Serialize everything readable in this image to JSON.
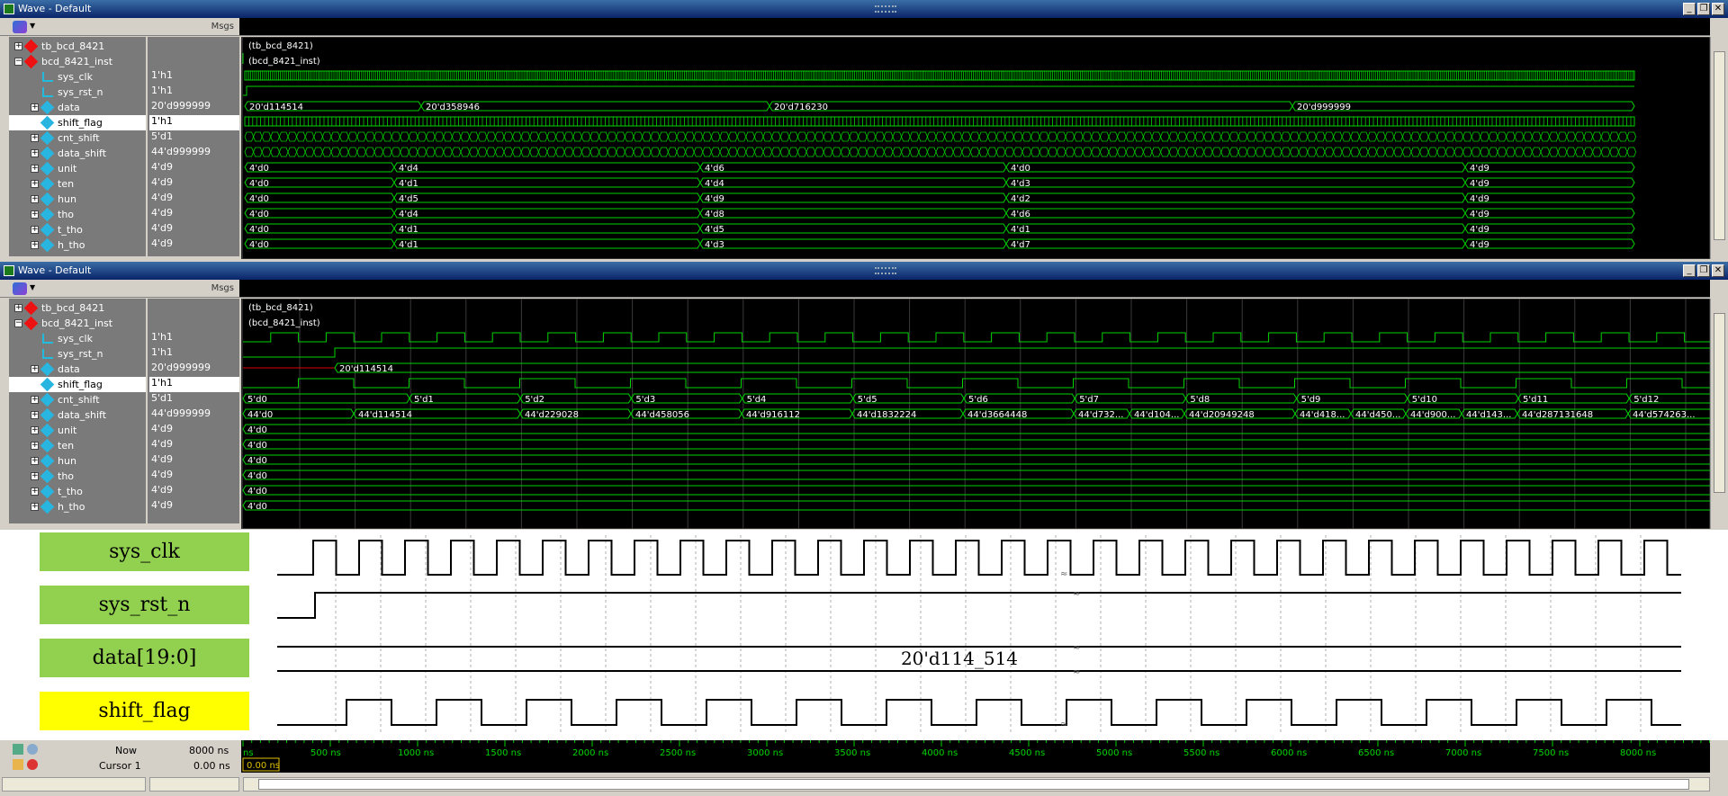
{
  "window1": {
    "title": "Wave - Default",
    "msgs_label": "Msgs",
    "group_labels": [
      "(tb_bcd_8421)",
      "(bcd_8421_inst)"
    ],
    "signals": [
      {
        "name": "tb_bcd_8421",
        "value": ""
      },
      {
        "name": "bcd_8421_inst",
        "value": ""
      },
      {
        "name": "sys_clk",
        "value": "1'h1"
      },
      {
        "name": "sys_rst_n",
        "value": "1'h1"
      },
      {
        "name": "data",
        "value": "20'd999999"
      },
      {
        "name": "shift_flag",
        "value": "1'h1"
      },
      {
        "name": "cnt_shift",
        "value": "5'd1"
      },
      {
        "name": "data_shift",
        "value": "44'd999999"
      },
      {
        "name": "unit",
        "value": "4'd9"
      },
      {
        "name": "ten",
        "value": "4'd9"
      },
      {
        "name": "hun",
        "value": "4'd9"
      },
      {
        "name": "tho",
        "value": "4'd9"
      },
      {
        "name": "t_tho",
        "value": "4'd9"
      },
      {
        "name": "h_tho",
        "value": "4'd9"
      }
    ],
    "data_bus": [
      "20'd114514",
      "20'd358946",
      "20'd716230",
      "20'd999999"
    ],
    "digit_buses": [
      [
        "4'd0",
        "4'd4",
        "4'd6",
        "4'd0",
        "4'd9"
      ],
      [
        "4'd0",
        "4'd1",
        "4'd4",
        "4'd3",
        "4'd9"
      ],
      [
        "4'd0",
        "4'd5",
        "4'd9",
        "4'd2",
        "4'd9"
      ],
      [
        "4'd0",
        "4'd4",
        "4'd8",
        "4'd6",
        "4'd9"
      ],
      [
        "4'd0",
        "4'd1",
        "4'd5",
        "4'd1",
        "4'd9"
      ],
      [
        "4'd0",
        "4'd1",
        "4'd3",
        "4'd7",
        "4'd9"
      ]
    ]
  },
  "window2": {
    "title": "Wave - Default",
    "msgs_label": "Msgs",
    "group_labels": [
      "(tb_bcd_8421)",
      "(bcd_8421_inst)"
    ],
    "signals": [
      {
        "name": "tb_bcd_8421",
        "value": ""
      },
      {
        "name": "bcd_8421_inst",
        "value": ""
      },
      {
        "name": "sys_clk",
        "value": "1'h1"
      },
      {
        "name": "sys_rst_n",
        "value": "1'h1"
      },
      {
        "name": "data",
        "value": "20'd999999"
      },
      {
        "name": "shift_flag",
        "value": "1'h1"
      },
      {
        "name": "cnt_shift",
        "value": "5'd1"
      },
      {
        "name": "data_shift",
        "value": "44'd999999"
      },
      {
        "name": "unit",
        "value": "4'd9"
      },
      {
        "name": "ten",
        "value": "4'd9"
      },
      {
        "name": "hun",
        "value": "4'd9"
      },
      {
        "name": "tho",
        "value": "4'd9"
      },
      {
        "name": "t_tho",
        "value": "4'd9"
      },
      {
        "name": "h_tho",
        "value": "4'd9"
      }
    ],
    "data_value": "20'd114514",
    "cnt_shift_labels": [
      "5'd0",
      "5'd1",
      "5'd2",
      "5'd3",
      "5'd4",
      "5'd5",
      "5'd6",
      "5'd7",
      "5'd8",
      "5'd9",
      "5'd10",
      "5'd11",
      "5'd12"
    ],
    "data_shift_labels": [
      "44'd0",
      "44'd114514",
      "44'd229028",
      "44'd458056",
      "44'd916112",
      "44'd1832224",
      "44'd3664448",
      "44'd732...",
      "44'd104...",
      "44'd20949248",
      "44'd418...",
      "44'd450...",
      "44'd900...",
      "44'd143...",
      "44'd287131648",
      "44'd574263..."
    ],
    "digit_value": "4'd0"
  },
  "diagram": {
    "signals": [
      {
        "label": "sys_clk",
        "color": "#92d050"
      },
      {
        "label": "sys_rst_n",
        "color": "#92d050"
      },
      {
        "label": "data[19:0]",
        "color": "#92d050"
      },
      {
        "label": "shift_flag",
        "color": "#ffff00"
      }
    ],
    "data_value": "20'd114_514"
  },
  "status": {
    "now_label": "Now",
    "now_value": "8000 ns",
    "cursor_label": "Cursor 1",
    "cursor_value": "0.00 ns",
    "cursor_tag": "0.00 ns",
    "timeline_labels": [
      "ns",
      "500 ns",
      "1000 ns",
      "1500 ns",
      "2000 ns",
      "2500 ns",
      "3000 ns",
      "3500 ns",
      "4000 ns",
      "4500 ns",
      "5000 ns",
      "5500 ns",
      "6000 ns",
      "6500 ns",
      "7000 ns",
      "7500 ns",
      "8000 ns"
    ]
  },
  "colors": {
    "wave_green": "#00d400",
    "wave_bg": "#000000",
    "title_blue": "#0a246a",
    "panel_grey": "#7a7a7a"
  }
}
